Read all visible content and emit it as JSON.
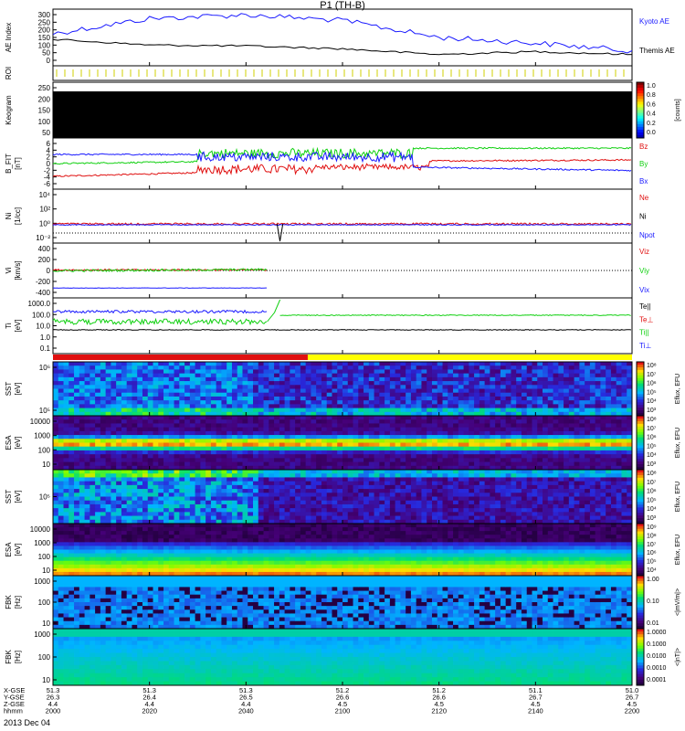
{
  "title": "P1 (TH-B)",
  "date_label": "2013 Dec 04",
  "colors": {
    "blue": "#1a1aff",
    "red": "#e01010",
    "green": "#10d010",
    "black": "#000000",
    "yellow": "#ffff00"
  },
  "chart_data": [
    {
      "type": "line",
      "id": "ae",
      "ylabel": "AE Index",
      "ylim": [
        0,
        300
      ],
      "yticks": [
        "300",
        "250",
        "200",
        "150",
        "100",
        "50",
        "0"
      ],
      "x": [
        "2000",
        "2020",
        "2040",
        "2100",
        "2120",
        "2140",
        "2200"
      ],
      "series": [
        {
          "name": "Kyoto AE",
          "color": "#1a1aff",
          "values": [
            170,
            250,
            270,
            240,
            150,
            120,
            80
          ]
        },
        {
          "name": "Themis AE",
          "color": "#000000",
          "values": [
            140,
            110,
            105,
            90,
            60,
            75,
            60
          ]
        }
      ]
    },
    {
      "type": "strip",
      "id": "roi",
      "ylabel": "ROI"
    },
    {
      "type": "heatmap",
      "id": "keogram",
      "ylabel": "Keogram",
      "yticks": [
        "250",
        "200",
        "150",
        "100",
        "50"
      ],
      "colorbar": {
        "ticks": [
          "1.0",
          "0.8",
          "0.6",
          "0.4",
          "0.2",
          "0.0"
        ],
        "label": "[counts]"
      }
    },
    {
      "type": "line",
      "id": "bfield",
      "ylabel": "B_FIT",
      "yunit": "[nT]",
      "yticks": [
        "6",
        "4",
        "2",
        "0",
        "-2",
        "-4",
        "-6"
      ],
      "series": [
        {
          "name": "Bz",
          "color": "#e01010"
        },
        {
          "name": "By",
          "color": "#10d010"
        },
        {
          "name": "Bx",
          "color": "#1a1aff"
        }
      ]
    },
    {
      "type": "line",
      "id": "density",
      "ylabel": "Ni",
      "yunit": "[1/cc]",
      "yticks": [
        "10⁴",
        "10²",
        "10⁰",
        "10⁻²"
      ],
      "series": [
        {
          "name": "Ne",
          "color": "#e01010"
        },
        {
          "name": "Ni",
          "color": "#000000"
        },
        {
          "name": "Npot",
          "color": "#1a1aff"
        }
      ]
    },
    {
      "type": "line",
      "id": "velocity",
      "ylabel": "Vi",
      "yunit": "[km/s]",
      "yticks": [
        "400",
        "200",
        "0",
        "-200",
        "-400"
      ],
      "series": [
        {
          "name": "Viz",
          "color": "#e01010"
        },
        {
          "name": "Viy",
          "color": "#10d010"
        },
        {
          "name": "Vix",
          "color": "#1a1aff"
        }
      ]
    },
    {
      "type": "line",
      "id": "temperature",
      "ylabel": "Ti",
      "yunit": "[eV]",
      "yticks": [
        "1000.0",
        "100.0",
        "10.0",
        "1.0",
        "0.1"
      ],
      "series": [
        {
          "name": "Te||",
          "color": "#000000"
        },
        {
          "name": "Te⊥",
          "color": "#e01010"
        },
        {
          "name": "Ti||",
          "color": "#10d010"
        },
        {
          "name": "Ti⊥",
          "color": "#1a1aff"
        }
      ]
    },
    {
      "type": "strip",
      "id": "mode_bar"
    },
    {
      "type": "heatmap",
      "id": "sst_ion",
      "ylabel": "SST",
      "yunit": "[eV]",
      "yticks": [
        "10⁶",
        "10⁵"
      ],
      "colorbar": {
        "ticks": [
          "10⁸",
          "10⁷",
          "10⁶",
          "10⁵",
          "10⁴",
          "10³"
        ],
        "label": "Eflux, EFU"
      }
    },
    {
      "type": "heatmap",
      "id": "esa_ion",
      "ylabel": "ESA",
      "yunit": "[eV]",
      "yticks": [
        "10000",
        "1000",
        "100",
        "10"
      ],
      "colorbar": {
        "ticks": [
          "10⁸",
          "10⁷",
          "10⁶",
          "10⁵",
          "10⁴",
          "10³"
        ],
        "label": "Eflux, EFU"
      }
    },
    {
      "type": "heatmap",
      "id": "sst_elec",
      "ylabel": "SST",
      "yunit": "[eV]",
      "yticks": [
        "10⁵"
      ],
      "colorbar": {
        "ticks": [
          "10⁸",
          "10⁷",
          "10⁶",
          "10⁵",
          "10⁴",
          "10³"
        ],
        "label": "Eflux, EFU"
      }
    },
    {
      "type": "heatmap",
      "id": "esa_elec",
      "ylabel": "ESA",
      "yunit": "[eV]",
      "yticks": [
        "10000",
        "1000",
        "100",
        "10"
      ],
      "colorbar": {
        "ticks": [
          "10⁹",
          "10⁸",
          "10⁷",
          "10⁶",
          "10⁵",
          "10⁴"
        ],
        "label": "Eflux, EFU"
      }
    },
    {
      "type": "heatmap",
      "id": "fbk_e",
      "ylabel": "FBK",
      "yunit": "[Hz]",
      "yticks": [
        "1000",
        "100",
        "10"
      ],
      "colorbar": {
        "ticks": [
          "1.00",
          "0.10",
          "0.01"
        ],
        "label": "<|mV/m|>"
      }
    },
    {
      "type": "heatmap",
      "id": "fbk_b",
      "ylabel": "FBK",
      "yunit": "[Hz]",
      "yticks": [
        "1000",
        "100",
        "10"
      ],
      "colorbar": {
        "ticks": [
          "1.0000",
          "0.1000",
          "0.0100",
          "0.0010",
          "0.0001"
        ],
        "label": "<|nT|>"
      }
    }
  ],
  "x_axis": {
    "row_labels": [
      "X-GSE",
      "Y-GSE",
      "Z-GSE",
      "hhmm"
    ],
    "columns": [
      {
        "x": "51.3",
        "y": "26.3",
        "z": "4.4",
        "t": "2000"
      },
      {
        "x": "51.3",
        "y": "26.4",
        "z": "4.4",
        "t": "2020"
      },
      {
        "x": "51.3",
        "y": "26.5",
        "z": "4.4",
        "t": "2040"
      },
      {
        "x": "51.2",
        "y": "26.6",
        "z": "4.5",
        "t": "2100"
      },
      {
        "x": "51.2",
        "y": "26.6",
        "z": "4.5",
        "t": "2120"
      },
      {
        "x": "51.1",
        "y": "26.7",
        "z": "4.5",
        "t": "2140"
      },
      {
        "x": "51.0",
        "y": "26.7",
        "z": "4.5",
        "t": "2200"
      }
    ]
  }
}
